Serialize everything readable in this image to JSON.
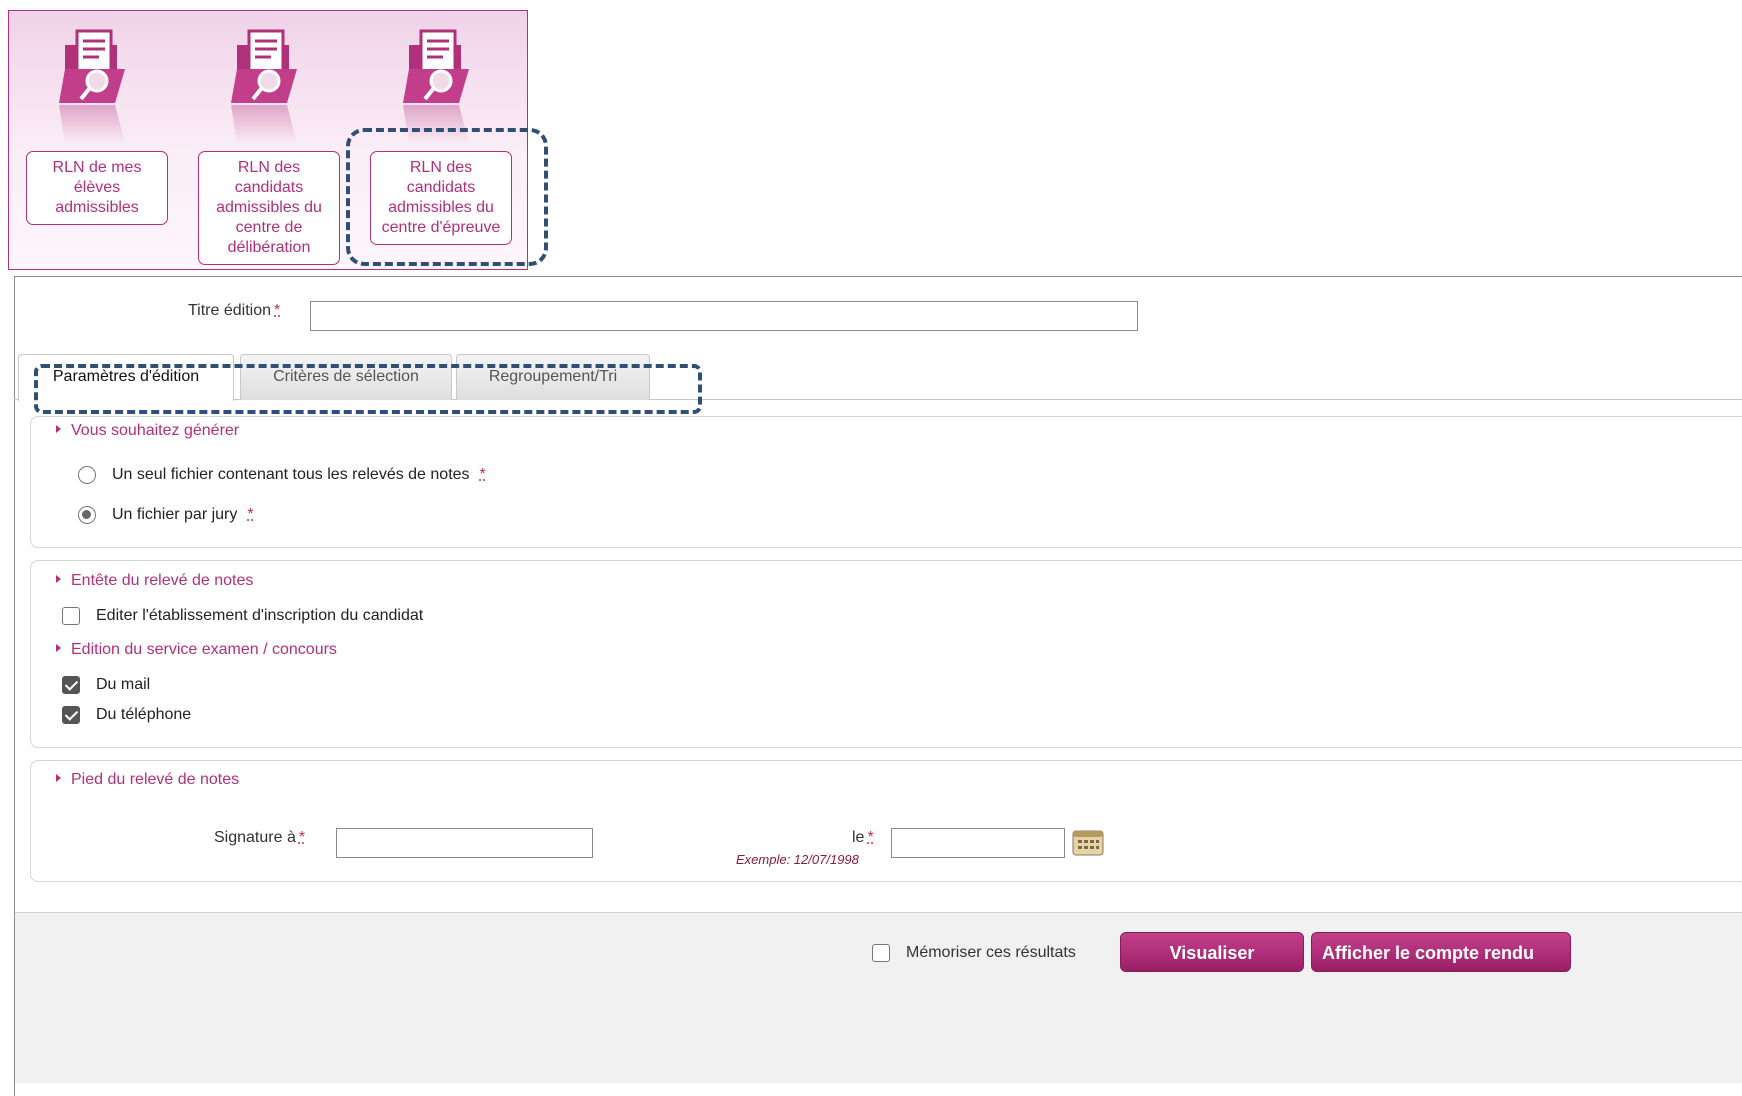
{
  "tiles": [
    {
      "label": "RLN de mes élèves admissibles"
    },
    {
      "label": "RLN des candidats admissibles du centre de délibération"
    },
    {
      "label": "RLN des candidats admissibles du centre d'épreuve"
    }
  ],
  "form": {
    "title_label": "Titre édition",
    "required_mark": "*",
    "title_value": ""
  },
  "tabs": [
    {
      "label": "Paramètres d'édition",
      "active": true
    },
    {
      "label": "Critères de sélection",
      "active": false
    },
    {
      "label": "Regroupement/Tri",
      "active": false
    }
  ],
  "section_generate": {
    "legend": "Vous souhaitez générer",
    "options": [
      {
        "label": "Un seul fichier contenant tous les relevés de notes",
        "checked": false
      },
      {
        "label": "Un fichier par jury",
        "checked": true
      }
    ]
  },
  "section_header": {
    "legend": "Entête du relevé de notes",
    "edit_school_label": "Editer l'établissement d'inscription du candidat",
    "edit_school_checked": false,
    "service_legend": "Edition du service examen / concours",
    "mail_label": "Du mail",
    "mail_checked": true,
    "phone_label": "Du téléphone",
    "phone_checked": true
  },
  "section_footer": {
    "legend": "Pied du relevé de notes",
    "signature_label": "Signature à",
    "signature_value": "",
    "date_label": "le",
    "date_example": "Exemple: 12/07/1998",
    "date_value": ""
  },
  "actions": {
    "remember_label": "Mémoriser ces résultats",
    "remember_checked": false,
    "visualize_label": "Visualiser",
    "report_label": "Afficher le compte rendu"
  },
  "icons": {
    "tile_icon": "folder-document-search-icon",
    "calendar": "calendar-icon"
  },
  "colors": {
    "accent": "#b0307a",
    "highlight_dash": "#2f4f76"
  }
}
